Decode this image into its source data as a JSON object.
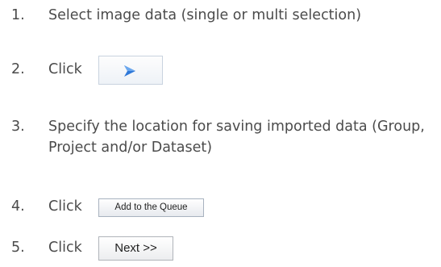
{
  "steps": [
    {
      "number": "1.",
      "text": "Select image data (single or multi selection)"
    },
    {
      "number": "2.",
      "text": "Click",
      "button_icon": "chevron-right-icon"
    },
    {
      "number": "3.",
      "text": "Specify the location for saving imported data (Group, Project and/or Dataset)"
    },
    {
      "number": "4.",
      "text": "Click",
      "button_label": "Add to the Queue"
    },
    {
      "number": "5.",
      "text": "Click",
      "button_label": "Next >>"
    }
  ],
  "colors": {
    "text": "#4b4b4b",
    "arrow_icon": "#2f78d8"
  }
}
